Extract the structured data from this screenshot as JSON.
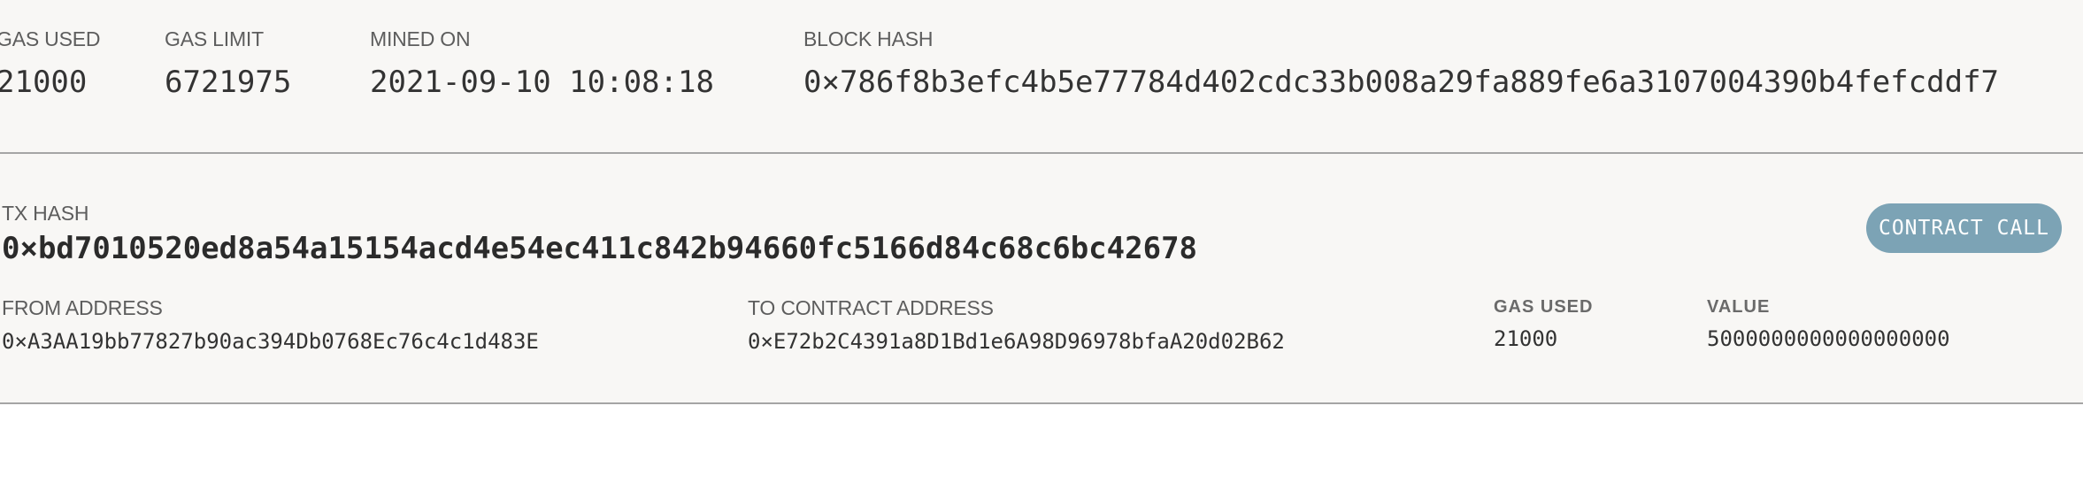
{
  "block": {
    "gas_used": {
      "label": "GAS USED",
      "value": "21000"
    },
    "gas_limit": {
      "label": "GAS LIMIT",
      "value": "6721975"
    },
    "mined_on": {
      "label": "MINED ON",
      "value": "2021-09-10 10:08:18"
    },
    "block_hash": {
      "label": "BLOCK HASH",
      "value": "0×786f8b3efc4b5e77784d402cdc33b008a29fa889fe6a3107004390b4fefcddf7"
    }
  },
  "transaction": {
    "tx_hash": {
      "label": "TX HASH",
      "value": "0×bd7010520ed8a54a15154acd4e54ec411c842b94660fc5166d84c68c6bc42678"
    },
    "type_badge": "CONTRACT CALL",
    "from_address": {
      "label": "FROM ADDRESS",
      "value": "0×A3AA19bb77827b90ac394Db0768Ec76c4c1d483E"
    },
    "to_address": {
      "label": "TO CONTRACT ADDRESS",
      "value": "0×E72b2C4391a8D1Bd1e6A98D96978bfaA20d02B62"
    },
    "gas_used": {
      "label": "GAS USED",
      "value": "21000"
    },
    "value": {
      "label": "VALUE",
      "value": "5000000000000000000"
    }
  },
  "colors": {
    "badge": "#7ca3b5",
    "section_bg": "#f8f7f5",
    "divider": "#a5a5a5"
  }
}
